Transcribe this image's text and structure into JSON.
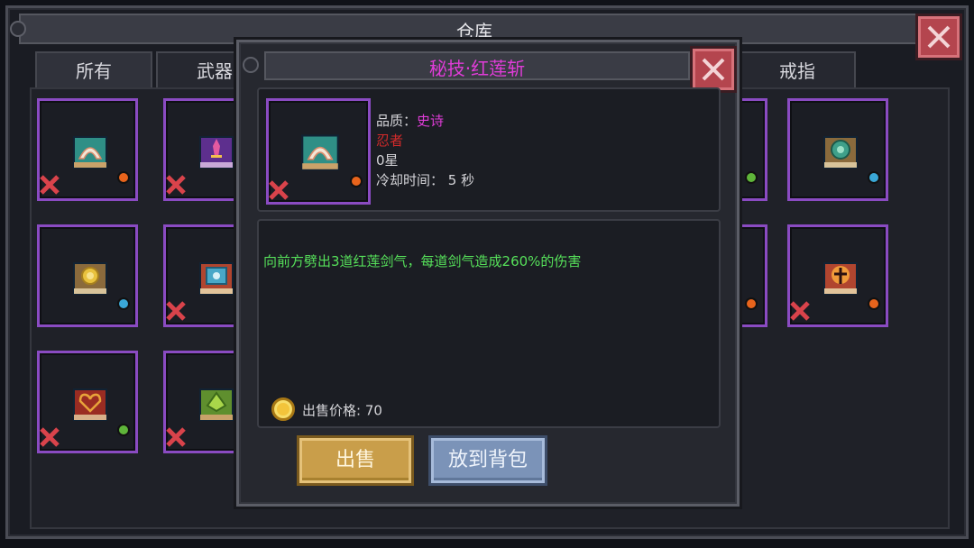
{
  "warehouse": {
    "title": "仓库",
    "tabs": [
      "所有",
      "武器",
      "戒指"
    ]
  },
  "slots": [
    {
      "icon": "arch-book-icon",
      "gem": "#e8641c",
      "cursed": true
    },
    {
      "icon": "sword-book-icon",
      "gem": "",
      "cursed": true
    },
    {
      "icon": "gear-book-icon",
      "gem": "#3aa7d6",
      "cursed": false
    },
    {
      "icon": "sun-book-icon",
      "gem": "#3aa7d6",
      "cursed": false
    },
    {
      "icon": "eye-book-icon",
      "gem": "",
      "cursed": true
    },
    {
      "icon": "flame-book-icon",
      "gem": "#e8641c",
      "cursed": true
    },
    {
      "icon": "heart-book-icon",
      "gem": "#5fb53a",
      "cursed": true
    },
    {
      "icon": "leaf-book-icon",
      "gem": "",
      "cursed": true
    }
  ],
  "dialog": {
    "title": "秘技·红莲斩",
    "quality_label": "品质：",
    "quality_value": "史诗",
    "class_name": "忍者",
    "stars": "0星",
    "cooldown": "冷却时间： 5 秒",
    "description": "向前方劈出3道红莲剑气，每道剑气造成260%的伤害",
    "price_label": "出售价格: 70",
    "sell_button": "出售",
    "to_bag_button": "放到背包"
  },
  "colors": {
    "quality_epic": "#e03cd8",
    "class_red": "#d22a2a",
    "description_green": "#56e05a",
    "slot_border": "#8a4bc2"
  }
}
